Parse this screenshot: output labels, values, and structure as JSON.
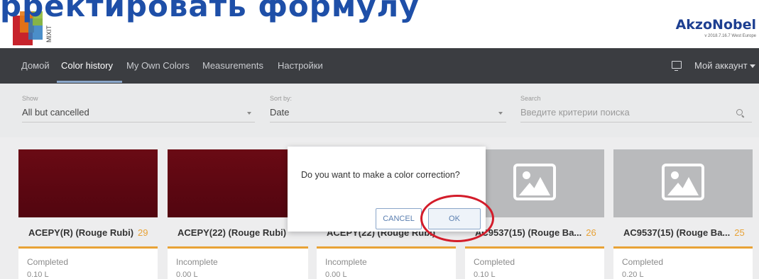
{
  "overlay_title": "рректировать формулу",
  "header": {
    "logo_text": "MIXIT",
    "brand_name": "AkzoNobel",
    "version": "v 2018.7.16.7 West Europe"
  },
  "nav": {
    "items": [
      {
        "label": "Домой"
      },
      {
        "label": "Color history"
      },
      {
        "label": "My Own Colors"
      },
      {
        "label": "Measurements"
      },
      {
        "label": "Настройки"
      }
    ],
    "active": "Color history",
    "account_label": "Мой аккаунт"
  },
  "filters": {
    "show": {
      "label": "Show",
      "value": "All but cancelled"
    },
    "sort": {
      "label": "Sort by:",
      "value": "Date"
    },
    "search": {
      "label": "Search",
      "placeholder": "Введите критерии поиска"
    }
  },
  "cards": [
    {
      "title": "ACEPY(R) (Rouge Rubi)",
      "count": "29",
      "status": "Completed",
      "volume": "0.10 L"
    },
    {
      "title": "ACEPY(22) (Rouge Rubi)",
      "count": "",
      "status": "Incomplete",
      "volume": "0.00 L"
    },
    {
      "title": "ACEPY(22) (Rouge Rubi)",
      "count": "",
      "status": "Incomplete",
      "volume": "0.00 L"
    },
    {
      "title": "AC9537(15) (Rouge Ba...",
      "count": "26",
      "status": "Completed",
      "volume": "0.10 L"
    },
    {
      "title": "AC9537(15) (Rouge Ba...",
      "count": "25",
      "status": "Completed",
      "volume": "0.20 L"
    }
  ],
  "modal": {
    "message": "Do you want to make a color correction?",
    "cancel_label": "CANCEL",
    "ok_label": "OK"
  },
  "colors": {
    "nav_bg": "#3b3d41",
    "accent_orange": "#e8a236",
    "brand_blue": "#1d3f91",
    "swatch_red": "#5b0711",
    "highlight_red": "#d31c2a"
  }
}
